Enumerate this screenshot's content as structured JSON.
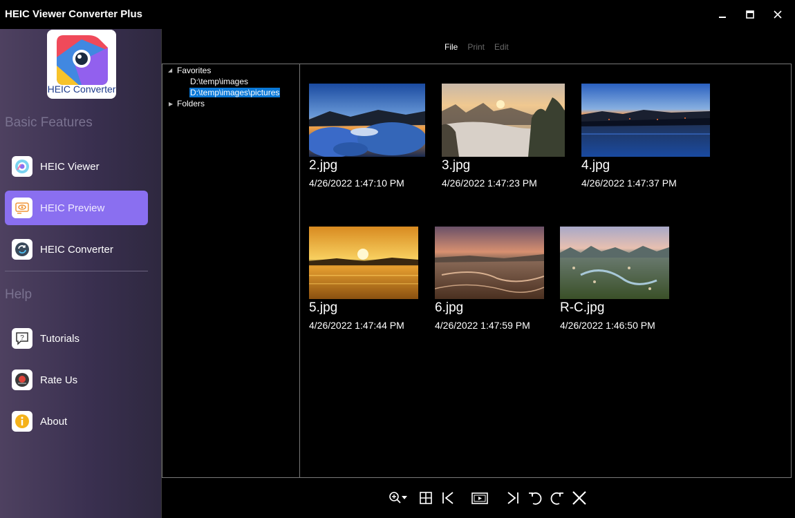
{
  "window": {
    "title": "HEIC Viewer Converter Plus",
    "minimize_icon": "minimize-icon",
    "maximize_icon": "maximize-icon",
    "close_icon": "close-icon"
  },
  "sidebar": {
    "logo_text": "HEIC Converter",
    "sections": [
      {
        "title": "Basic Features",
        "items": [
          {
            "label": "HEIC Viewer",
            "icon": "eye-icon",
            "active": false
          },
          {
            "label": "HEIC Preview",
            "icon": "preview-icon",
            "active": true
          },
          {
            "label": "HEIC Converter",
            "icon": "convert-icon",
            "active": false
          }
        ]
      },
      {
        "title": "Help",
        "items": [
          {
            "label": "Tutorials",
            "icon": "help-bubble-icon",
            "active": false
          },
          {
            "label": "Rate Us",
            "icon": "rate-icon",
            "active": false
          },
          {
            "label": "About",
            "icon": "info-icon",
            "active": false
          }
        ]
      }
    ]
  },
  "menu": {
    "file": "File",
    "print": "Print",
    "edit": "Edit"
  },
  "tree": {
    "favorites": "Favorites",
    "fav_items": [
      "D:\\temp\\images",
      "D:\\temp\\images\\pictures"
    ],
    "selected_index": 1,
    "folders": "Folders"
  },
  "images": [
    {
      "name": "2.jpg",
      "date": "4/26/2022 1:47:10 PM"
    },
    {
      "name": "3.jpg",
      "date": "4/26/2022 1:47:23 PM"
    },
    {
      "name": "4.jpg",
      "date": "4/26/2022 1:47:37 PM"
    },
    {
      "name": "5.jpg",
      "date": "4/26/2022 1:47:44 PM"
    },
    {
      "name": "6.jpg",
      "date": "4/26/2022 1:47:59 PM"
    },
    {
      "name": "R-C.jpg",
      "date": "4/26/2022 1:46:50 PM"
    }
  ],
  "toolbar": [
    "zoom-icon",
    "grid-view-icon",
    "first-image-icon",
    "slideshow-icon",
    "last-image-icon",
    "rotate-left-icon",
    "rotate-right-icon",
    "close-image-icon"
  ],
  "colors": {
    "accent": "#8a6ff0",
    "selection": "#0a78d7",
    "sidebar_top": "#4e4160"
  }
}
